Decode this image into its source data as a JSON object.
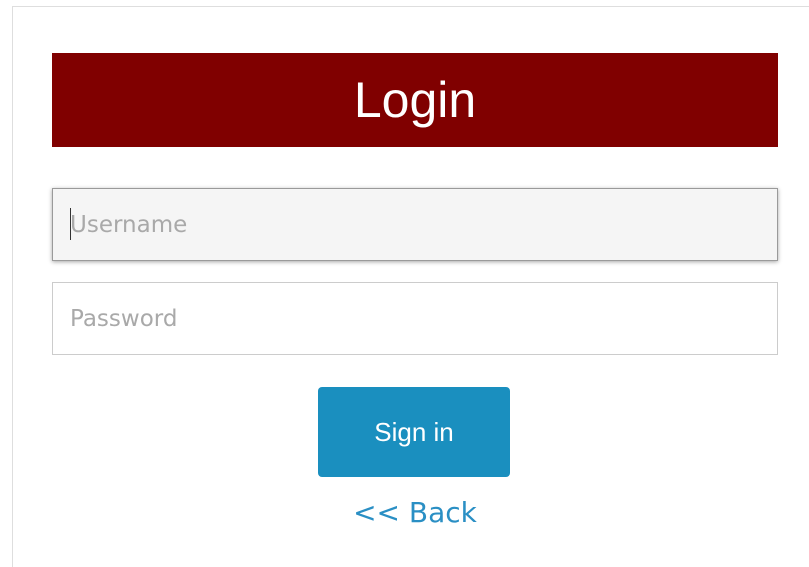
{
  "header": {
    "title": "Login",
    "color": "#800000"
  },
  "form": {
    "username": {
      "value": "",
      "placeholder": "Username"
    },
    "password": {
      "value": "",
      "placeholder": "Password"
    },
    "submit_label": "Sign in",
    "submit_color": "#1a8fbf",
    "back_label": "<< Back",
    "link_color": "#2a8fc4"
  }
}
